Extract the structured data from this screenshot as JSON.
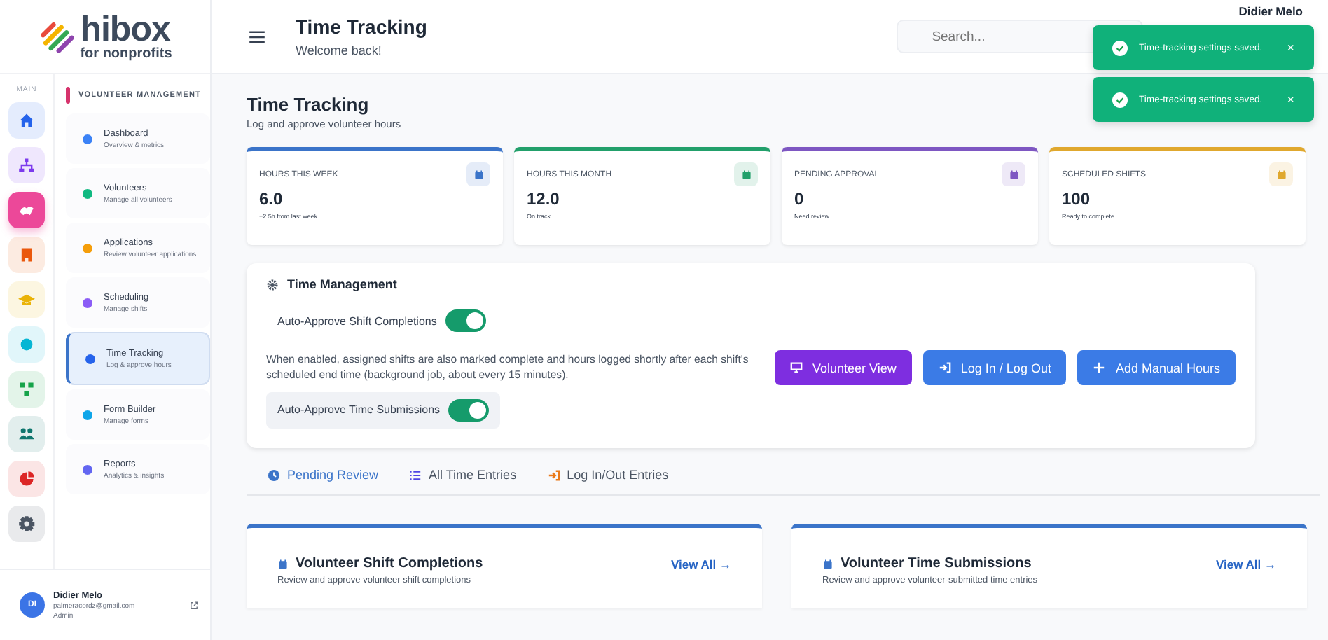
{
  "brand": {
    "name": "hibox",
    "tagline": "for nonprofits"
  },
  "header": {
    "title": "Time Tracking",
    "subtitle": "Welcome back!",
    "search": {
      "placeholder": "Search..."
    },
    "user_name": "Didier Melo"
  },
  "toasts": [
    {
      "text": "Time-tracking settings saved.",
      "close": "×"
    },
    {
      "text": "Time-tracking settings saved.",
      "close": "×"
    }
  ],
  "rail": {
    "label": "MAIN",
    "items": [
      {
        "color": "#2563eb",
        "selected": false
      },
      {
        "color": "#7c3aed",
        "selected": false
      },
      {
        "color": "#ec4899",
        "selected": true
      },
      {
        "color": "#ea580c",
        "selected": false
      },
      {
        "color": "#eab308",
        "selected": false
      },
      {
        "color": "#06b6d4",
        "selected": false
      },
      {
        "color": "#16a34a",
        "selected": false
      },
      {
        "color": "#0f766e",
        "selected": false
      },
      {
        "color": "#dc2626",
        "selected": false
      },
      {
        "color": "#4b5563",
        "selected": false
      }
    ]
  },
  "sidebar": {
    "section": "VOLUNTEER MANAGEMENT",
    "items": [
      {
        "label": "Dashboard",
        "sub": "Overview & metrics",
        "color": "#3b82f6",
        "selected": false
      },
      {
        "label": "Volunteers",
        "sub": "Manage all volunteers",
        "color": "#10b981",
        "selected": false
      },
      {
        "label": "Applications",
        "sub": "Review volunteer applications",
        "color": "#f59e0b",
        "selected": false
      },
      {
        "label": "Scheduling",
        "sub": "Manage shifts",
        "color": "#8b5cf6",
        "selected": false
      },
      {
        "label": "Time Tracking",
        "sub": "Log & approve hours",
        "color": "#2563eb",
        "selected": true
      },
      {
        "label": "Form Builder",
        "sub": "Manage forms",
        "color": "#0ea5e9",
        "selected": false
      },
      {
        "label": "Reports",
        "sub": "Analytics & insights",
        "color": "#6366f1",
        "selected": false
      }
    ]
  },
  "user": {
    "initials": "DI",
    "name": "Didier Melo",
    "email": "palmeracordz@gmail.com",
    "role": "Admin"
  },
  "page": {
    "title": "Time Tracking",
    "subtitle": "Log and approve volunteer hours"
  },
  "stats": [
    {
      "label": "HOURS THIS WEEK",
      "value": "6.0",
      "note": "+2.5h from last week",
      "color": "#3b74c9"
    },
    {
      "label": "HOURS THIS MONTH",
      "value": "12.0",
      "note": "On track",
      "color": "#22a06b"
    },
    {
      "label": "PENDING APPROVAL",
      "value": "0",
      "note": "Need review",
      "color": "#7e57c2"
    },
    {
      "label": "SCHEDULED SHIFTS",
      "value": "100",
      "note": "Ready to complete",
      "color": "#e0a82e"
    }
  ],
  "management": {
    "title": "Time Management",
    "settings": [
      {
        "label": "Auto-Approve Shift Completions",
        "on": true,
        "highlighted": false
      },
      {
        "label": "Auto-Approve Time Submissions",
        "on": true,
        "highlighted": true
      }
    ],
    "description": "When enabled, assigned shifts are also marked complete and hours logged shortly after each shift's scheduled end time (background job, about every 15 minutes).",
    "buttons": [
      {
        "label": "Volunteer View",
        "kind": "purple"
      },
      {
        "label": "Log In / Log Out",
        "kind": "blue"
      },
      {
        "label": "Add Manual Hours",
        "kind": "blue"
      }
    ]
  },
  "tabs": [
    {
      "label": "Pending Review",
      "selected": true
    },
    {
      "label": "All Time Entries",
      "selected": false
    },
    {
      "label": "Log In/Out Entries",
      "selected": false
    }
  ],
  "panels": [
    {
      "title": "Volunteer Shift Completions",
      "link": "View All →",
      "subtitle": "Review and approve volunteer shift completions"
    },
    {
      "title": "Volunteer Time Submissions",
      "link": "View All →",
      "subtitle": "Review and approve volunteer-submitted time entries"
    }
  ]
}
